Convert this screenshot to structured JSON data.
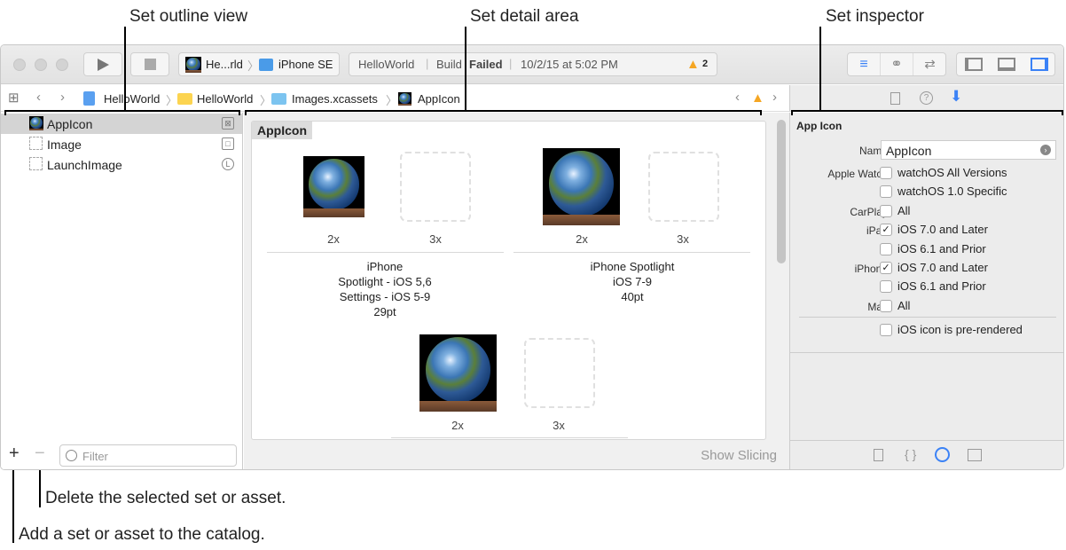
{
  "callouts": {
    "outline": "Set outline view",
    "detail": "Set detail area",
    "inspector": "Set inspector",
    "delete": "Delete the selected set or asset.",
    "add": "Add a set or asset to the catalog."
  },
  "toolbar": {
    "scheme": "He...rld",
    "device": "iPhone SE",
    "activity": {
      "project": "HelloWorld",
      "build_prefix": "Build",
      "build_status": "Failed",
      "timestamp": "10/2/15 at 5:02 PM",
      "warnings": "2"
    }
  },
  "breadcrumb": [
    "HelloWorld",
    "HelloWorld",
    "Images.xcassets",
    "AppIcon"
  ],
  "outline": {
    "items": [
      {
        "label": "AppIcon",
        "selected": true
      },
      {
        "label": "Image"
      },
      {
        "label": "LaunchImage"
      }
    ],
    "add": "+",
    "remove": "−",
    "filter_placeholder": "Filter"
  },
  "detail": {
    "set_title": "AppIcon",
    "groups": [
      {
        "scales": [
          "2x",
          "3x"
        ],
        "lines": [
          "iPhone",
          "Spotlight - iOS 5,6",
          "Settings - iOS 5-9",
          "29pt"
        ]
      },
      {
        "scales": [
          "2x",
          "3x"
        ],
        "lines": [
          "iPhone Spotlight",
          "iOS 7-9",
          "40pt"
        ]
      },
      {
        "scales": [
          "2x",
          "3x"
        ],
        "lines": []
      }
    ],
    "show_slicing": "Show Slicing"
  },
  "inspector": {
    "title": "App Icon",
    "name_label": "Name",
    "name_value": "AppIcon",
    "rows": [
      {
        "label": "Apple Watch",
        "option": "watchOS All Versions",
        "checked": false
      },
      {
        "label": "",
        "option": "watchOS 1.0 Specific",
        "checked": false
      },
      {
        "label": "CarPlay",
        "option": "All",
        "checked": false
      },
      {
        "label": "iPad",
        "option": "iOS 7.0 and Later",
        "checked": true
      },
      {
        "label": "",
        "option": "iOS 6.1 and Prior",
        "checked": false
      },
      {
        "label": "iPhone",
        "option": "iOS 7.0 and Later",
        "checked": true
      },
      {
        "label": "",
        "option": "iOS 6.1 and Prior",
        "checked": false
      },
      {
        "label": "Mac",
        "option": "All",
        "checked": false
      }
    ],
    "prerendered": {
      "option": "iOS icon is pre-rendered",
      "checked": false
    }
  },
  "colors": {
    "accent": "#3b82f6",
    "warning": "#f5a623"
  }
}
